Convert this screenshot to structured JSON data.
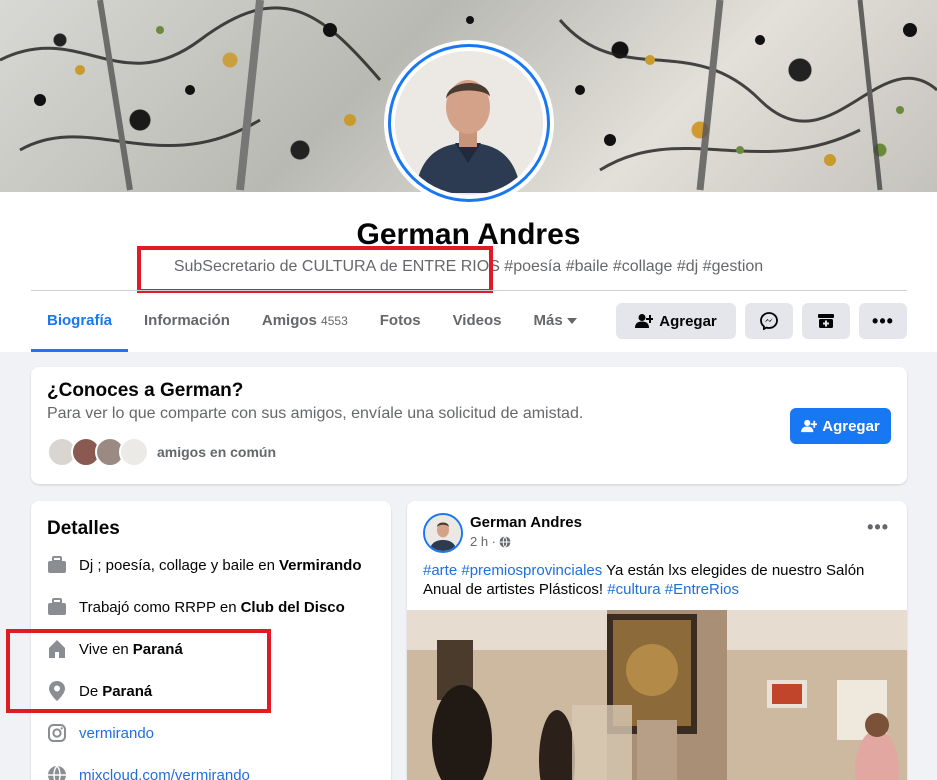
{
  "profile": {
    "name": "German Andres",
    "bio_highlight": "SubSecretario de CULTURA de ENTRE RIOS",
    "bio_rest": " #poesía #baile #collage #dj #gestion"
  },
  "tabs": [
    {
      "label": "Biografía",
      "count": ""
    },
    {
      "label": "Información",
      "count": ""
    },
    {
      "label": "Amigos",
      "count": "4553"
    },
    {
      "label": "Fotos",
      "count": ""
    },
    {
      "label": "Videos",
      "count": ""
    },
    {
      "label": "Más",
      "count": ""
    }
  ],
  "actions": {
    "add_label": "Agregar"
  },
  "know": {
    "title": "¿Conoces a German?",
    "subtitle": "Para ver lo que comparte con sus amigos, envíale una solicitud de amistad.",
    "mutual": "amigos en común",
    "add_label": "Agregar"
  },
  "details": {
    "title": "Detalles",
    "rows": [
      {
        "icon": "briefcase-icon",
        "prefix": "Dj ; poesía, collage y baile en",
        "bold": "Vermirando"
      },
      {
        "icon": "briefcase-icon",
        "prefix": "Trabajó como RRPP en",
        "bold": "Club del Disco"
      },
      {
        "icon": "home-icon",
        "prefix": "Vive en",
        "bold": "Paraná"
      },
      {
        "icon": "location-pin-icon",
        "prefix": "De",
        "bold": "Paraná"
      },
      {
        "icon": "instagram-icon",
        "link": "vermirando"
      },
      {
        "icon": "globe-icon",
        "link": "mixcloud.com/vermirando"
      }
    ]
  },
  "post": {
    "author": "German Andres",
    "time": "2 h ·",
    "tags_start": "#arte #premiosprovinciales",
    "text_mid": " Ya están lxs elegides de nuestro Salón Anual de artistes Plásticos! ",
    "tags_end": "#cultura #EntreRios"
  },
  "colors": {
    "accent": "#1877f2",
    "highlight_box": "#e01b24"
  }
}
